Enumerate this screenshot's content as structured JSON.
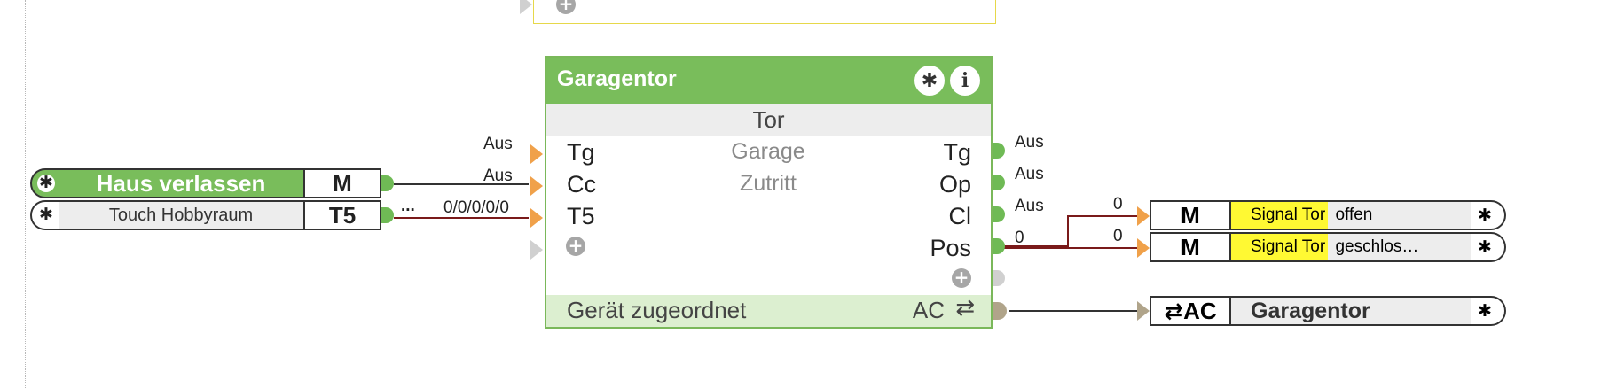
{
  "top_block": {
    "add_icon": "plus-icon"
  },
  "main_block": {
    "title": "Garagentor",
    "subtitle": "Tor",
    "room": "Garage",
    "function": "Zutritt",
    "inputs": [
      "Tg",
      "Cc",
      "T5"
    ],
    "input_values": [
      "Aus",
      "Aus",
      "0/0/0/0/0"
    ],
    "outputs": [
      "Tg",
      "Op",
      "Cl",
      "Pos"
    ],
    "output_values": [
      "Aus",
      "Aus",
      "Aus",
      "0"
    ],
    "footer_label": "Gerät zugeordnet",
    "footer_type": "AC",
    "footer_icon": "swap-arrows-icon",
    "settings_icon": "gear-icon",
    "info_icon": "info-icon",
    "info_glyph": "i",
    "accent_color": "#79bd5b"
  },
  "left_rows": [
    {
      "label": "Haus verlassen",
      "type": "M"
    },
    {
      "label": "Touch Hobbyraum",
      "type": "T5",
      "ellipsis": "..."
    }
  ],
  "right_rows": [
    {
      "type": "M",
      "label_highlight": "Signal Tor",
      "label_rest": "offen",
      "in_value": "0"
    },
    {
      "type": "M",
      "label_highlight": "Signal Tor",
      "label_rest": "geschlos…",
      "in_value": "0"
    },
    {
      "type": "AC",
      "label": "Garagentor",
      "icon": "swap-arrows-icon"
    }
  ]
}
